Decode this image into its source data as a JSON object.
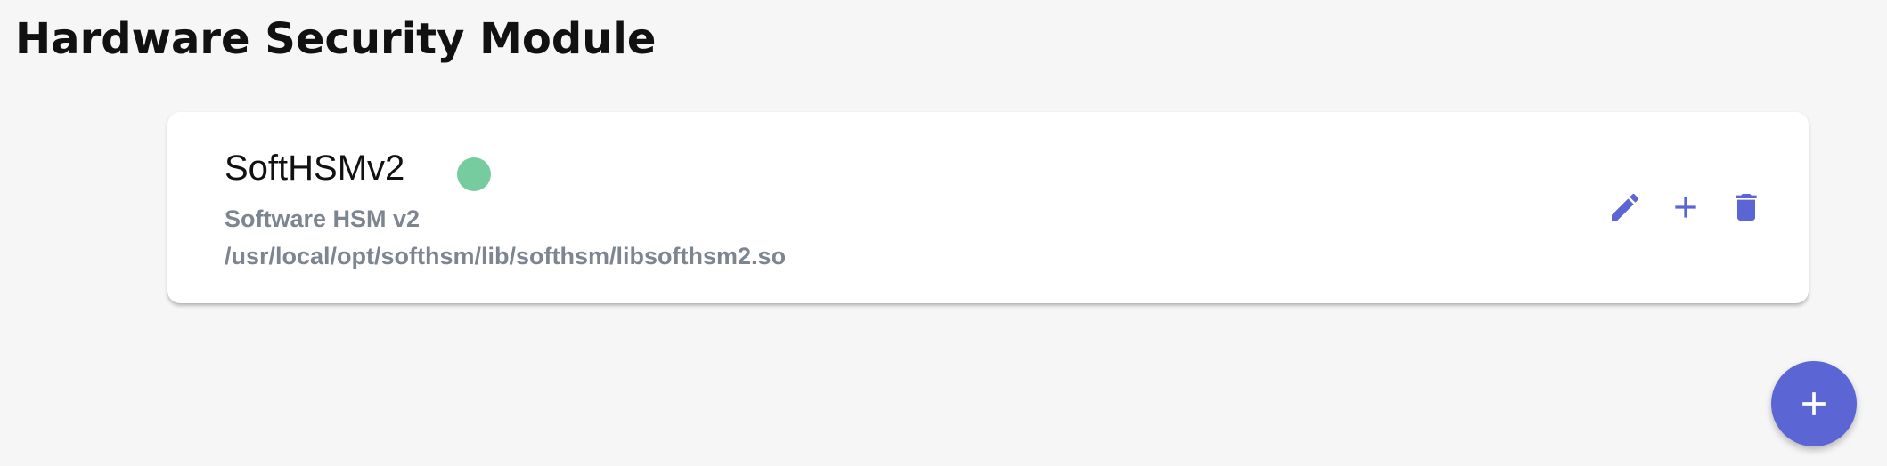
{
  "page": {
    "title": "Hardware Security Module"
  },
  "hsm_list": [
    {
      "name": "SoftHSMv2",
      "description": "Software HSM v2",
      "library_path": "/usr/local/opt/softhsm/lib/softhsm/libsofthsm2.so",
      "status_color": "#76cc9f",
      "actions": [
        {
          "icon": "pencil-icon",
          "name": "edit"
        },
        {
          "icon": "plus-icon",
          "name": "add"
        },
        {
          "icon": "trash-icon",
          "name": "delete"
        }
      ]
    }
  ],
  "fab": {
    "icon": "plus-icon"
  },
  "colors": {
    "accent": "#5c65d4",
    "status_ok": "#76cc9f",
    "background": "#f6f6f6",
    "secondary_text": "#7d8690"
  }
}
